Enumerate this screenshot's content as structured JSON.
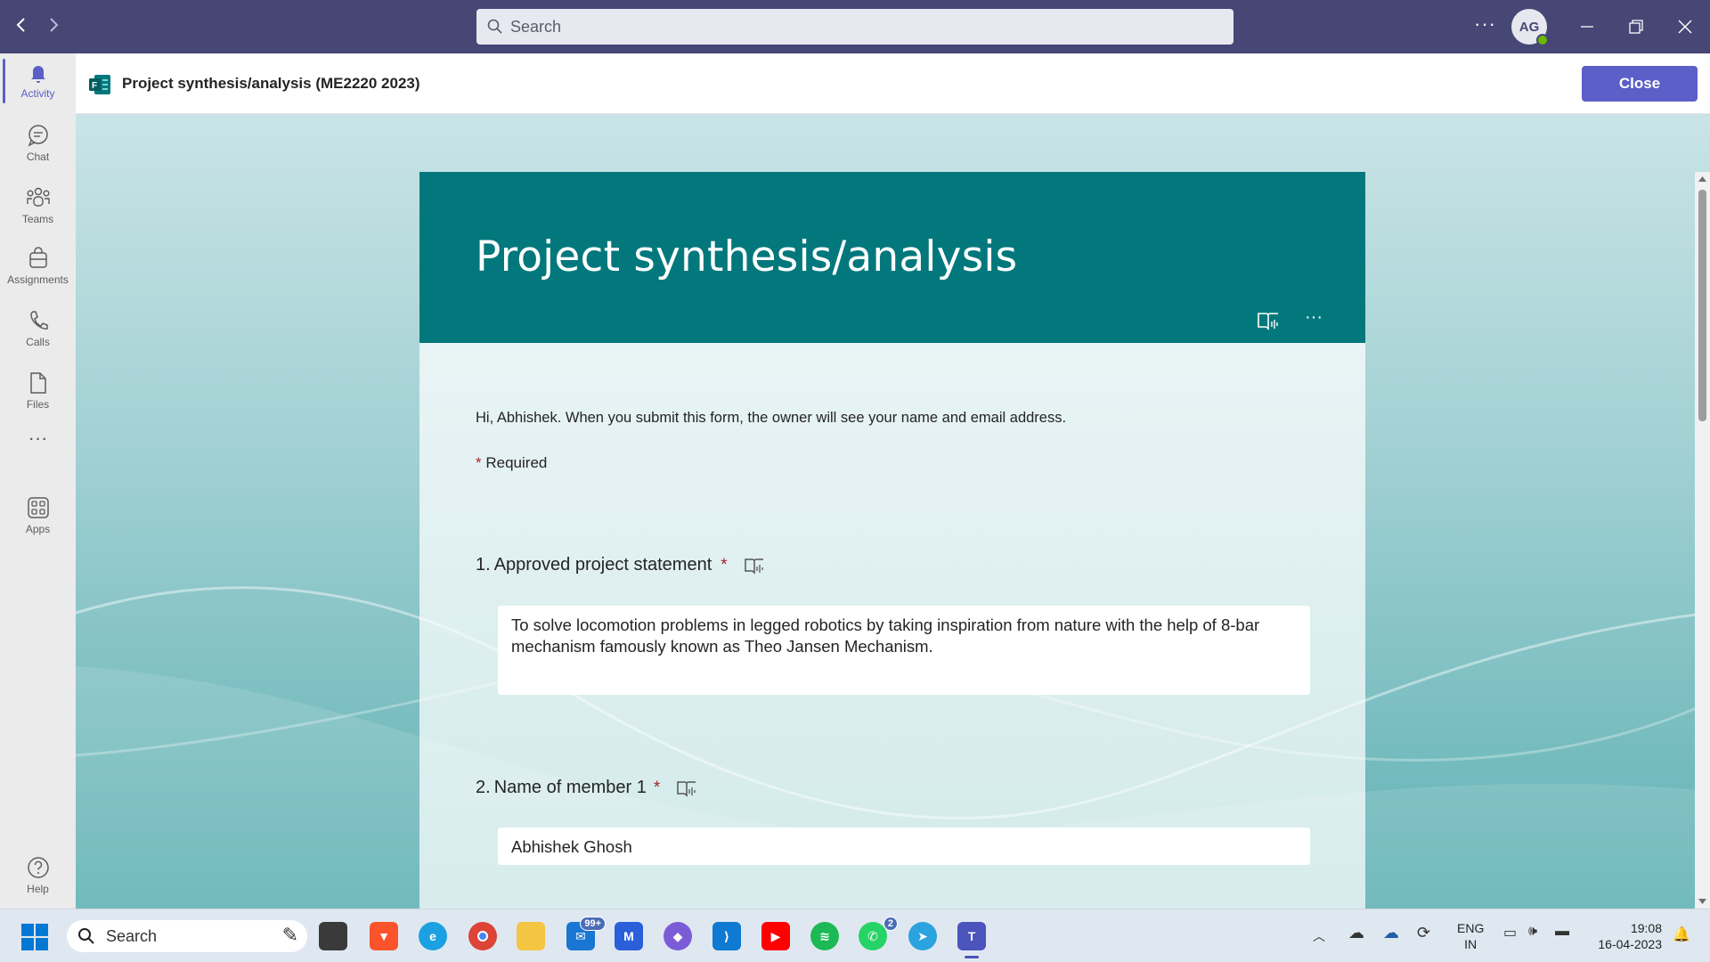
{
  "titlebar": {
    "search_placeholder": "Search",
    "avatar_initials": "AG"
  },
  "rail": {
    "items": [
      {
        "label": "Activity",
        "icon": "bell-icon"
      },
      {
        "label": "Chat",
        "icon": "chat-icon"
      },
      {
        "label": "Teams",
        "icon": "teams-icon"
      },
      {
        "label": "Assignments",
        "icon": "assignments-icon"
      },
      {
        "label": "Calls",
        "icon": "phone-icon"
      },
      {
        "label": "Files",
        "icon": "file-icon"
      },
      {
        "label": "Apps",
        "icon": "apps-icon"
      },
      {
        "label": "Help",
        "icon": "help-icon"
      }
    ]
  },
  "app_header": {
    "title": "Project synthesis/analysis (ME2220 2023)",
    "close_label": "Close"
  },
  "form": {
    "title": "Project synthesis/analysis",
    "intro": "Hi, Abhishek. When you submit this form, the owner will see your name and email address.",
    "required_star": "*",
    "required_label": "Required",
    "questions": [
      {
        "number": "1.",
        "title": "Approved project statement",
        "star": "*",
        "answer": "To solve locomotion problems in legged robotics by taking inspiration from nature with the help of 8-bar mechanism famously known as Theo Jansen Mechanism."
      },
      {
        "number": "2.",
        "title": "Name of member 1",
        "star": "*",
        "answer": "Abhishek Ghosh"
      }
    ]
  },
  "taskbar": {
    "search_label": "Search",
    "mail_badge": "99+",
    "whatsapp_badge": "2",
    "lang_line1": "ENG",
    "lang_line2": "IN",
    "time": "19:08",
    "date": "16-04-2023"
  },
  "colors": {
    "titlebar": "#464775",
    "accent": "#5b5fc7",
    "form_header": "#03787c",
    "required_star": "#a4262c"
  }
}
